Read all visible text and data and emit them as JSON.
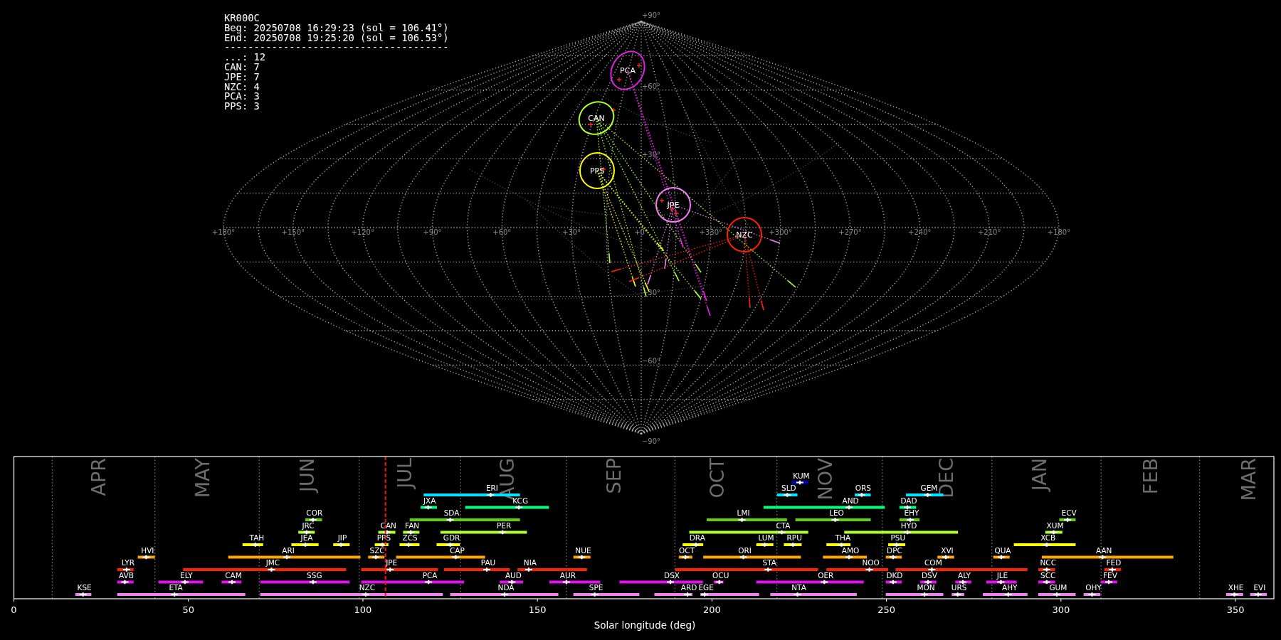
{
  "sky_map": {
    "info_lines": [
      "KR000C",
      "Beg: 20250708 16:29:23 (sol = 106.41°)",
      "End: 20250708 19:25:20 (sol = 106.53°)",
      "--------------------------------------",
      "...: 12",
      "CAN: 7",
      "JPE: 7",
      "NZC: 4",
      "PCA: 3",
      "PPS: 3"
    ],
    "lat_labels": [
      "+90°",
      "+60°",
      "+30°",
      "−30°",
      "−60°",
      "−90°"
    ],
    "lon_labels": [
      "+180°",
      "+150°",
      "+120°",
      "+90°",
      "+60°",
      "+30°",
      "+0°",
      "+330°",
      "+300°",
      "+270°",
      "+240°",
      "+210°",
      "+180°"
    ],
    "radiants": [
      {
        "code": "PCA",
        "color": "#e020e0"
      },
      {
        "code": "CAN",
        "color": "#adff2f"
      },
      {
        "code": "PPS",
        "color": "#ffff00"
      },
      {
        "code": "JPE",
        "color": "#ee82ee"
      },
      {
        "code": "NZC",
        "color": "#ff2000"
      }
    ]
  },
  "timeline": {
    "x_title": "Solar longitude (deg)",
    "x_ticks": [
      "0",
      "50",
      "100",
      "150",
      "200",
      "250",
      "300",
      "350"
    ],
    "months": [
      "APR",
      "MAY",
      "JUN",
      "JUL",
      "AUG",
      "SEP",
      "OCT",
      "NOV",
      "DEC",
      "JAN",
      "FEB",
      "MAR"
    ],
    "rows": [
      {
        "color": "#0000cd",
        "showers": [
          "KUM"
        ]
      },
      {
        "color": "#00e5ff",
        "showers": [
          "ERI",
          "SLD",
          "ORS",
          "GEM"
        ]
      },
      {
        "color": "#00ff7f",
        "showers": [
          "JXA",
          "KCG",
          "AND",
          "DAD"
        ]
      },
      {
        "color": "#60d000",
        "showers": [
          "COR",
          "SDA",
          "LMI",
          "LEO",
          "EHY",
          "ECV"
        ]
      },
      {
        "color": "#adff2f",
        "showers": [
          "JRC",
          "CAN",
          "FAN",
          "PER",
          "CTA",
          "HYD",
          "XUM"
        ]
      },
      {
        "color": "#ffff00",
        "showers": [
          "TAH",
          "JEA",
          "JIP",
          "PPS",
          "ZCS",
          "GDR",
          "DRA",
          "LUM",
          "RPU",
          "THA",
          "PSU",
          "XCB"
        ]
      },
      {
        "color": "#ffa500",
        "showers": [
          "HVI",
          "ARI",
          "SZC",
          "CAP",
          "NUE",
          "OCT",
          "ORI",
          "AMO",
          "DPC",
          "XVI",
          "QUA",
          "AAN"
        ]
      },
      {
        "color": "#ff2000",
        "showers": [
          "LYR",
          "JMC",
          "JPE",
          "PAU",
          "NIA",
          "STA",
          "NOO",
          "COM",
          "NCC",
          "FED"
        ]
      },
      {
        "color": "#e010f0",
        "showers": [
          "AVB",
          "ELY",
          "CAM",
          "SSG",
          "PCA",
          "AUD",
          "AUR",
          "DSX",
          "OCU",
          "OER",
          "DKD",
          "DSV",
          "ALY",
          "JLE",
          "SCC",
          "FEV"
        ]
      },
      {
        "color": "#ee82ee",
        "showers": [
          "KSE",
          "ETA",
          "NZC",
          "NDA",
          "SPE",
          "ARD",
          "EGE",
          "NTA",
          "MON",
          "URS",
          "AHY",
          "GUM",
          "OHY",
          "XHE",
          "EVI"
        ]
      }
    ]
  }
}
